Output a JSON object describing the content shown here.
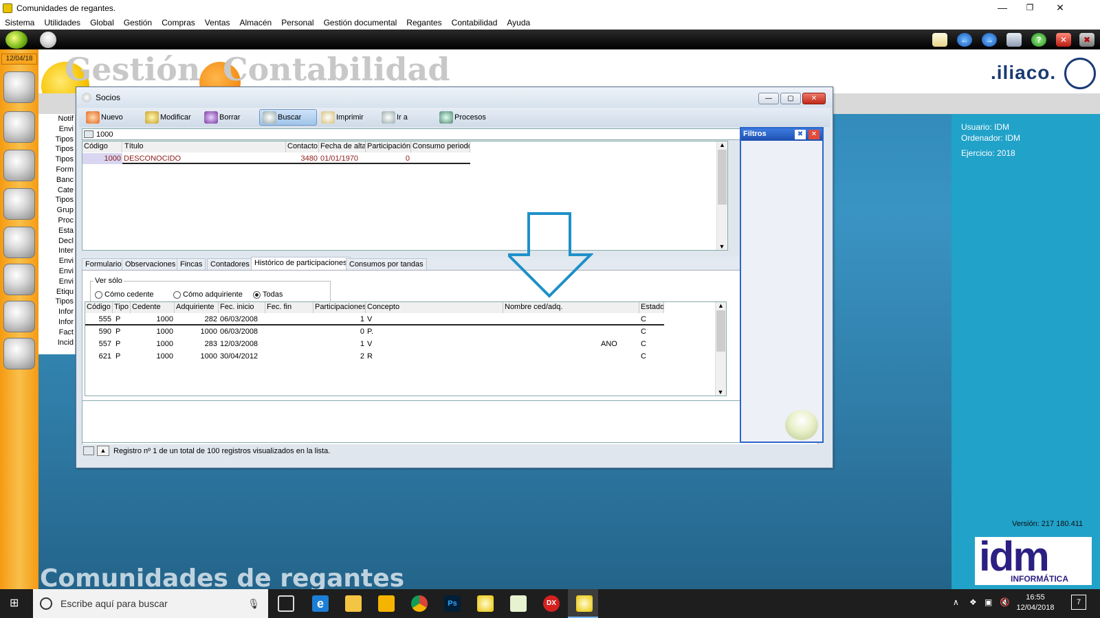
{
  "window": {
    "title": "Comunidades de regantes."
  },
  "menu": [
    "Sistema",
    "Utilidades",
    "Global",
    "Gestión",
    "Compras",
    "Ventas",
    "Almacén",
    "Personal",
    "Gestión documental",
    "Regantes",
    "Contabilidad",
    "Ayuda"
  ],
  "left_panel": {
    "date": "12/04/18"
  },
  "header": {
    "brand": ".iliaco.",
    "logo_left": "Gestión",
    "logo_right": "Contabilidad"
  },
  "bg_menu": [
    "Notif",
    "Envi",
    "Tipos",
    "Tipos",
    "Tipos",
    "Form",
    "Banc",
    "Cate",
    "Tipos",
    "Grup",
    "Proc",
    "Esta",
    "Decl",
    "Inter",
    "Envi",
    "Envi",
    "Envi",
    "Etiqu",
    "Tipos",
    "Infor",
    "Infor",
    "Fact",
    "Incid"
  ],
  "user_info": {
    "usuario": "Usuario: IDM",
    "ordenador": "Ordenador: IDM",
    "ejercicio": "Ejercicio: 2018",
    "version": "Versión: 217 180.411"
  },
  "bottom_title": "Comunidades de regantes",
  "idm_logo": {
    "big": "idm",
    "small": "INFORMÁTICA"
  },
  "socios": {
    "title": "Socios",
    "toolbar": {
      "nuevo": "Nuevo",
      "modificar": "Modificar",
      "borrar": "Borrar",
      "buscar": "Buscar",
      "imprimir": "Imprimir",
      "ira": "Ir a",
      "procesos": "Procesos"
    },
    "search_value": "1000",
    "main_grid": {
      "headers": [
        "Código",
        "Título",
        "Contacto",
        "Fecha de alta",
        "Participación",
        "Consumo periodo"
      ],
      "row": {
        "codigo": "1000",
        "titulo": "DESCONOCIDO",
        "contacto": "3480",
        "fecha": "01/01/1970",
        "participacion": "0",
        "consumo": ""
      }
    },
    "tabs": [
      "Formulario",
      "Observaciones",
      "Fincas",
      "Contadores",
      "Histórico de participaciones",
      "Consumos por tandas"
    ],
    "ver_solo": {
      "label": "Ver sólo",
      "options": [
        "Cómo cedente",
        "Cómo adquiriente",
        "Todas"
      ],
      "selected": "Todas"
    },
    "hist_grid": {
      "headers": [
        "Código",
        "Tipo",
        "Cedente",
        "Adquiriente",
        "Fec. inicio",
        "Fec. fin",
        "Participaciones",
        "Concepto",
        "Nombre ced/adq.",
        "Estado"
      ],
      "rows": [
        {
          "codigo": "555",
          "tipo": "P",
          "cedente": "1000",
          "adquiriente": "282",
          "inicio": "06/03/2008",
          "fin": "",
          "part": "1",
          "concepto": "V",
          "nombre": "",
          "estado": "C"
        },
        {
          "codigo": "590",
          "tipo": "P",
          "cedente": "1000",
          "adquiriente": "1000",
          "inicio": "06/03/2008",
          "fin": "",
          "part": "0",
          "concepto": "P.",
          "nombre": "",
          "estado": "C"
        },
        {
          "codigo": "557",
          "tipo": "P",
          "cedente": "1000",
          "adquiriente": "283",
          "inicio": "12/03/2008",
          "fin": "",
          "part": "1",
          "concepto": "V",
          "nombre": "ANO",
          "estado": "C"
        },
        {
          "codigo": "621",
          "tipo": "P",
          "cedente": "1000",
          "adquiriente": "1000",
          "inicio": "30/04/2012",
          "fin": "",
          "part": "2",
          "concepto": "R",
          "nombre": "",
          "estado": "C"
        }
      ]
    },
    "filtros": "Filtros",
    "status": "Registro nº 1 de un total de 100 registros visualizados en la lista."
  },
  "taskbar": {
    "search_placeholder": "Escribe aquí para buscar",
    "time": "16:55",
    "date": "12/04/2018",
    "notifications": "7"
  },
  "colors": {
    "accent_blue": "#1f95c9",
    "left_panel": "#f59a12",
    "arrow": "#1e90c8"
  }
}
